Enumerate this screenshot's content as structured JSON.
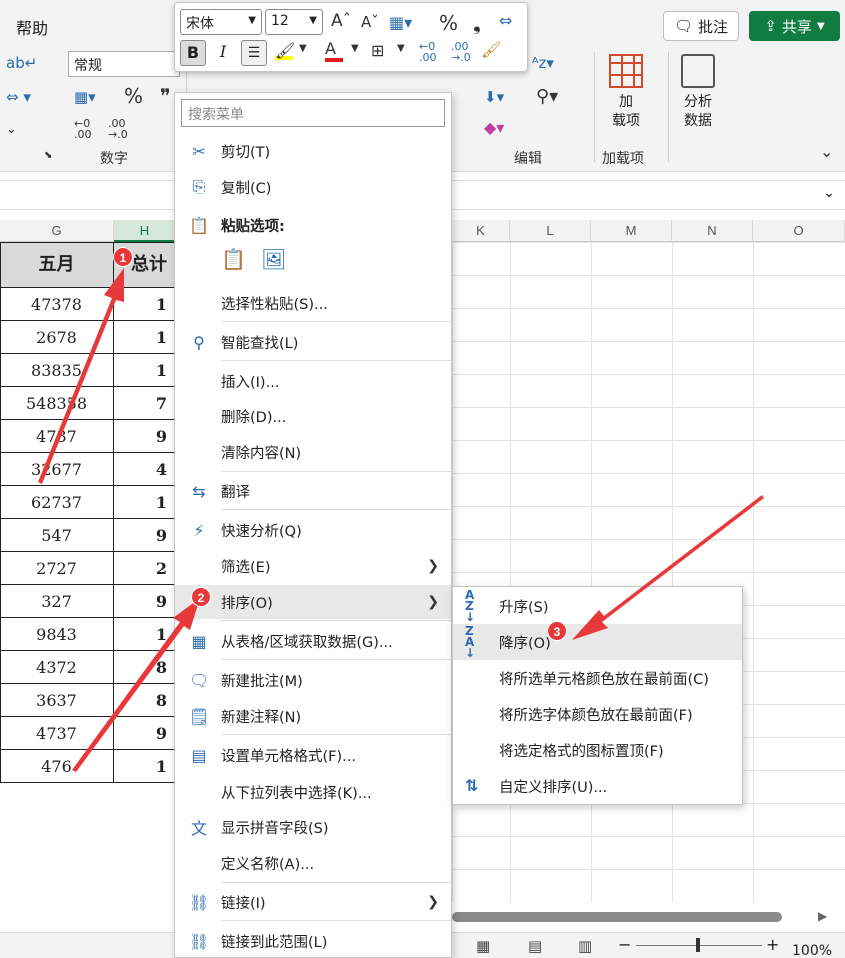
{
  "ribbon": {
    "tab_help": "帮助",
    "comment_label": "批注",
    "share_label": "共享",
    "number_format": "常规",
    "groups": {
      "number": "数字",
      "edit": "编辑",
      "addins": "加载项"
    },
    "addins_button": "加\n载项",
    "analyze_button": "分析\n数据"
  },
  "mini_toolbar": {
    "font_name": "宋体",
    "font_size": "12",
    "bold_label": "B",
    "italic_label": "I"
  },
  "grid": {
    "columns": [
      "G",
      "H",
      "K",
      "L",
      "M",
      "N",
      "O"
    ],
    "header_row": [
      "五月",
      "总计"
    ],
    "rows": [
      [
        "47378",
        "1"
      ],
      [
        "2678",
        "1"
      ],
      [
        "83835",
        "1"
      ],
      [
        "548358",
        "7"
      ],
      [
        "4737",
        "9"
      ],
      [
        "32677",
        "4"
      ],
      [
        "62737",
        "1"
      ],
      [
        "547",
        "9"
      ],
      [
        "2727",
        "2"
      ],
      [
        "327",
        "9"
      ],
      [
        "9843",
        "1"
      ],
      [
        "4372",
        "8"
      ],
      [
        "3637",
        "8"
      ],
      [
        "4737",
        "9"
      ],
      [
        "476",
        "1"
      ]
    ]
  },
  "context_menu": {
    "search_placeholder": "搜索菜单",
    "items": [
      {
        "label": "剪切(T)",
        "icon": "scissors-icon"
      },
      {
        "label": "复制(C)",
        "icon": "copy-icon"
      },
      {
        "label": "粘贴选项:",
        "icon": "paste-icon"
      },
      {
        "label": "选择性粘贴(S)...",
        "icon": ""
      },
      {
        "label": "智能查找(L)",
        "icon": "smart-lookup-icon"
      },
      {
        "label": "插入(I)...",
        "icon": ""
      },
      {
        "label": "删除(D)...",
        "icon": ""
      },
      {
        "label": "清除内容(N)",
        "icon": ""
      },
      {
        "label": "翻译",
        "icon": "translate-icon"
      },
      {
        "label": "快速分析(Q)",
        "icon": "quick-analysis-icon"
      },
      {
        "label": "筛选(E)",
        "icon": ""
      },
      {
        "label": "排序(O)",
        "icon": ""
      },
      {
        "label": "从表格/区域获取数据(G)...",
        "icon": "table-icon"
      },
      {
        "label": "新建批注(M)",
        "icon": "new-comment-icon"
      },
      {
        "label": "新建注释(N)",
        "icon": "new-note-icon"
      },
      {
        "label": "设置单元格格式(F)...",
        "icon": "format-cells-icon"
      },
      {
        "label": "从下拉列表中选择(K)...",
        "icon": ""
      },
      {
        "label": "显示拼音字段(S)",
        "icon": "phonetic-icon"
      },
      {
        "label": "定义名称(A)...",
        "icon": ""
      },
      {
        "label": "链接(I)",
        "icon": "link-icon"
      },
      {
        "label": "链接到此范围(L)",
        "icon": "link-range-icon"
      }
    ]
  },
  "sort_submenu": {
    "items": [
      {
        "label": "升序(S)",
        "icon": "sort-ascending-icon"
      },
      {
        "label": "降序(O)",
        "icon": "sort-descending-icon"
      },
      {
        "label": "将所选单元格颜色放在最前面(C)",
        "icon": ""
      },
      {
        "label": "将所选字体颜色放在最前面(F)",
        "icon": ""
      },
      {
        "label": "将选定格式的图标置顶(F)",
        "icon": ""
      },
      {
        "label": "自定义排序(U)...",
        "icon": "custom-sort-icon"
      }
    ]
  },
  "annotations": {
    "badge1": "1",
    "badge2": "2",
    "badge3": "3"
  },
  "status": {
    "zoom": "100%"
  },
  "colors": {
    "accent_green": "#107c41",
    "arrow_red": "#e8393a"
  }
}
